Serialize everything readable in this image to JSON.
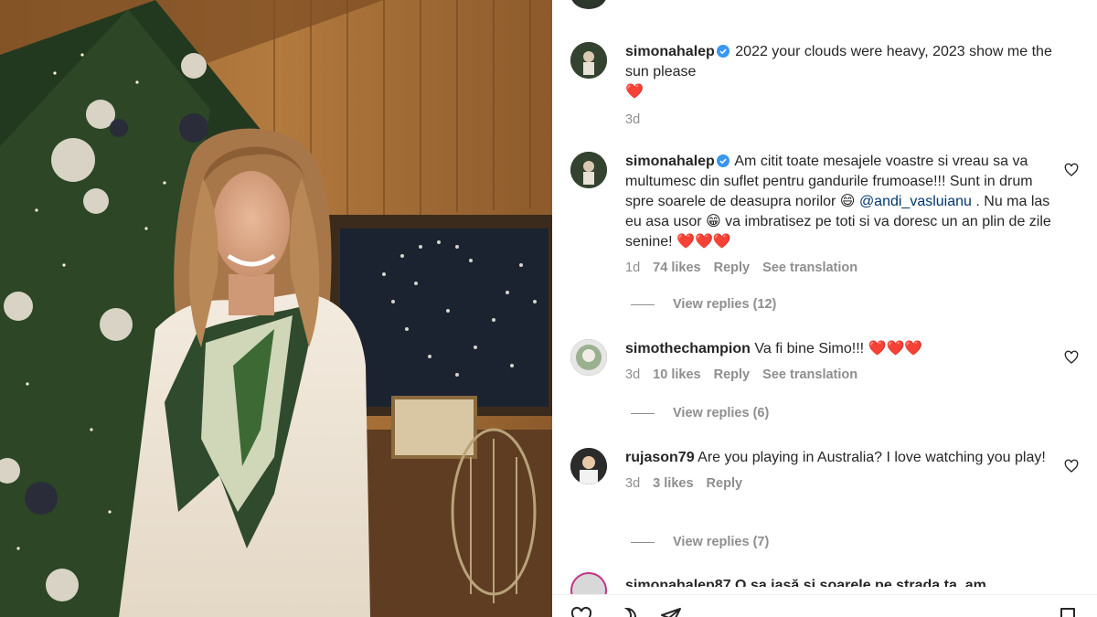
{
  "comments": [
    {
      "username": "simonahalep",
      "verified": true,
      "text": "2022 your clouds were heavy, 2023 show me the sun please",
      "emoji": "❤️",
      "time": "3d"
    },
    {
      "username": "simonahalep",
      "verified": true,
      "text_a": "Am citit toate mesajele voastre si vreau sa va multumesc din suflet pentru gandurile frumoase!!! Sunt in drum spre soarele de deasupra norilor 😄 ",
      "mention": "@andi_vasluianu",
      "text_b": " . Nu ma las eu asa usor 😁 va imbratisez pe toti si va doresc un an plin de zile senine! ❤️❤️❤️",
      "time": "1d",
      "likes": "74 likes",
      "reply": "Reply",
      "translate": "See translation",
      "view_replies": "View replies (12)"
    },
    {
      "username": "simothechampion",
      "text": "Va fi bine Simo!!! ❤️❤️❤️",
      "time": "3d",
      "likes": "10 likes",
      "reply": "Reply",
      "translate": "See translation",
      "view_replies": "View replies (6)"
    },
    {
      "username": "rujason79",
      "text": "Are you playing in Australia? I love watching you play!",
      "time": "3d",
      "likes": "3 likes",
      "reply": "Reply",
      "view_replies": "View replies (7)"
    }
  ],
  "truncated_comment": "simonahalep87  O sa iasă si soarele pe strada ta, am",
  "icons": [
    "heart-outline-icon",
    "comment-icon",
    "share-icon",
    "save-icon",
    "verified-badge-icon"
  ],
  "colors": {
    "verified": "#3897f0",
    "mention": "#00376b",
    "meta": "#8e8e8e"
  }
}
